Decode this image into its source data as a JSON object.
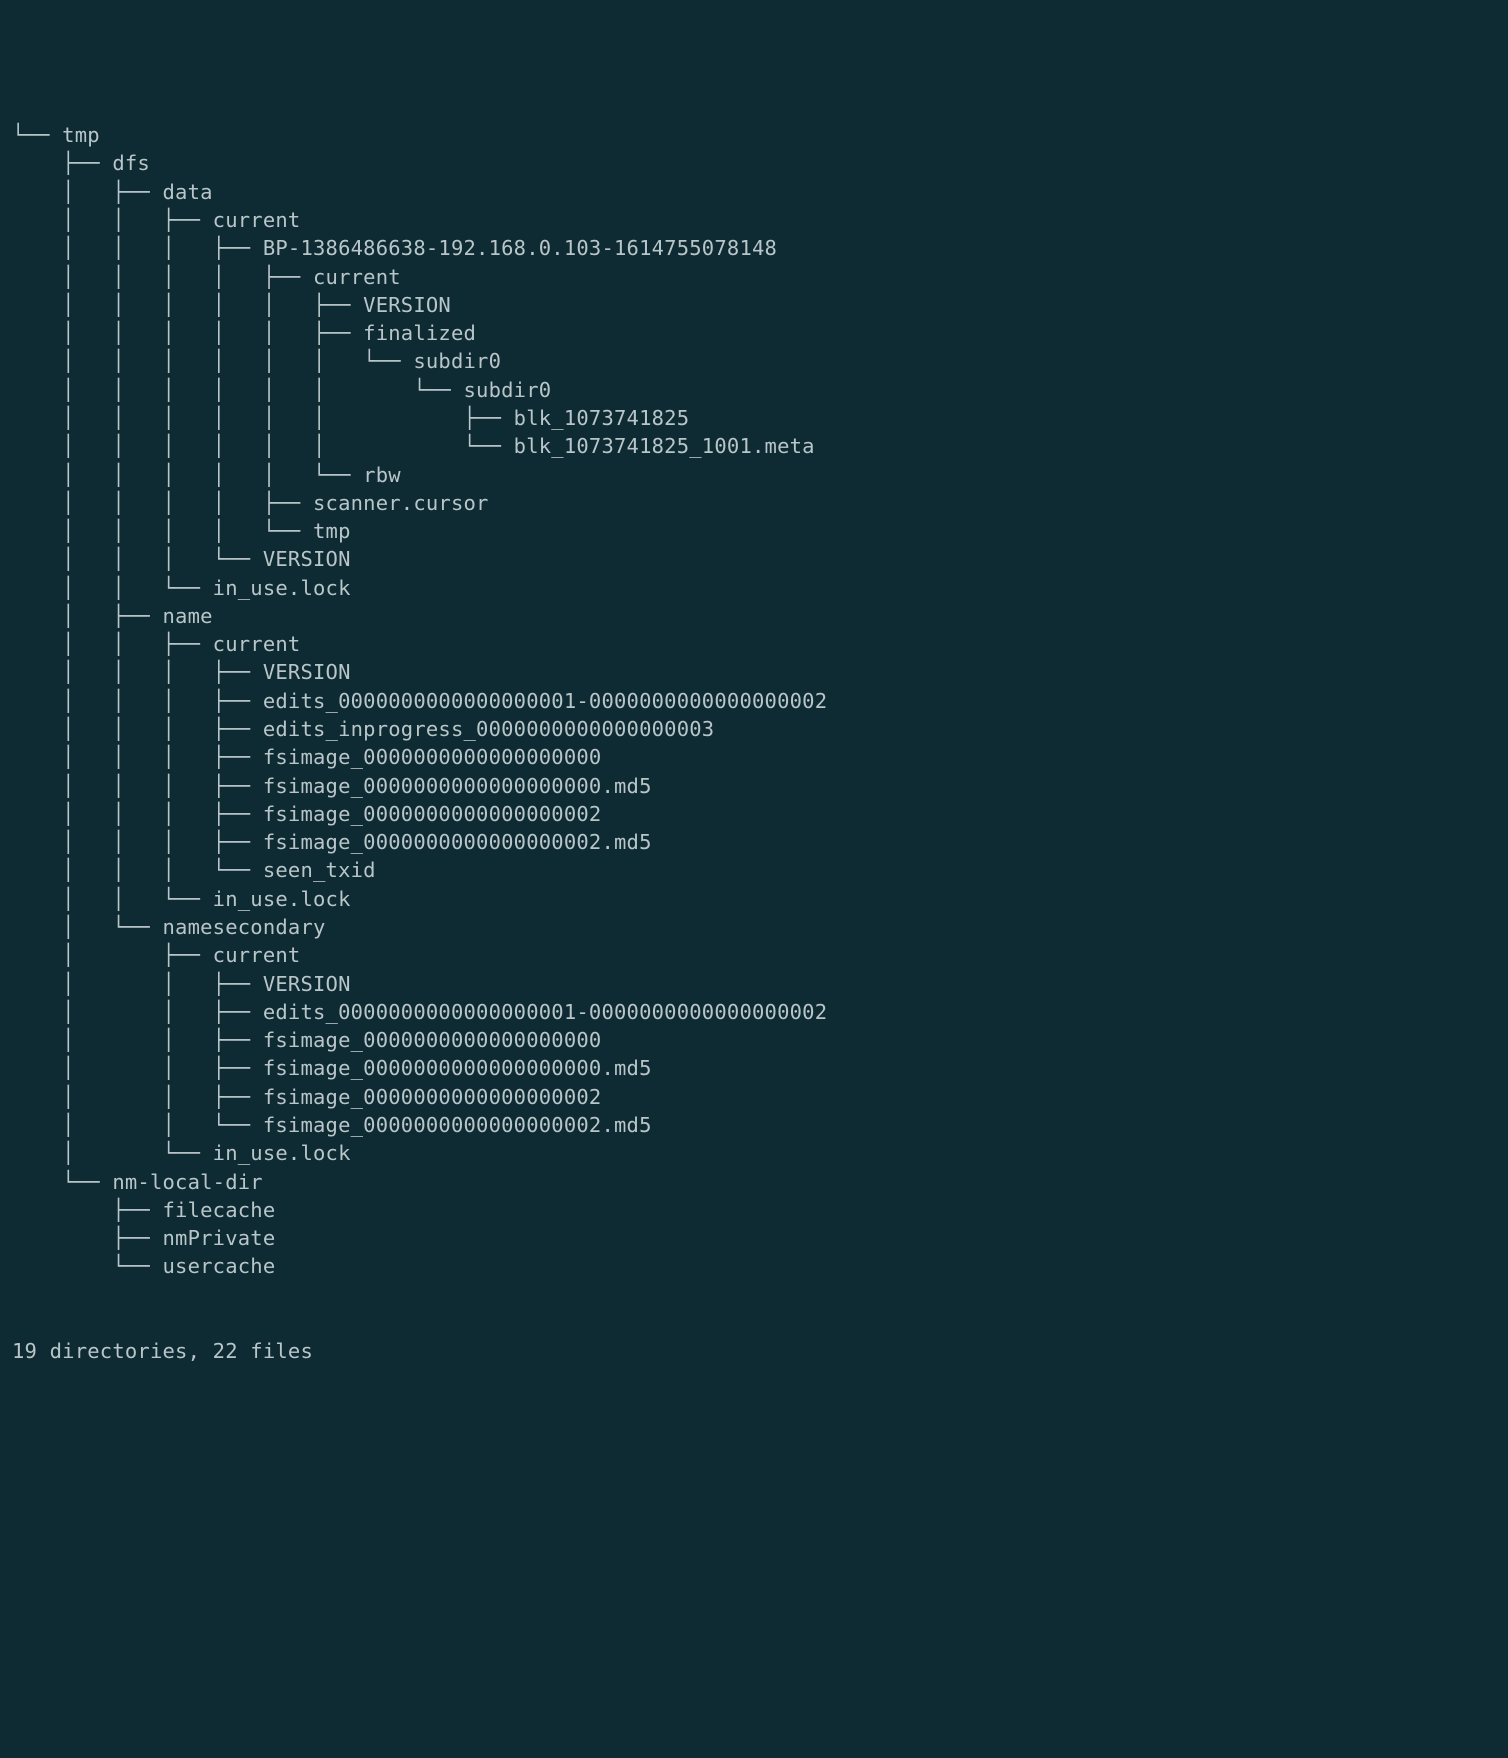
{
  "tree": {
    "lines": [
      "└── tmp",
      "    ├── dfs",
      "    │   ├── data",
      "    │   │   ├── current",
      "    │   │   │   ├── BP-1386486638-192.168.0.103-1614755078148",
      "    │   │   │   │   ├── current",
      "    │   │   │   │   │   ├── VERSION",
      "    │   │   │   │   │   ├── finalized",
      "    │   │   │   │   │   │   └── subdir0",
      "    │   │   │   │   │   │       └── subdir0",
      "    │   │   │   │   │   │           ├── blk_1073741825",
      "    │   │   │   │   │   │           └── blk_1073741825_1001.meta",
      "    │   │   │   │   │   └── rbw",
      "    │   │   │   │   ├── scanner.cursor",
      "    │   │   │   │   └── tmp",
      "    │   │   │   └── VERSION",
      "    │   │   └── in_use.lock",
      "    │   ├── name",
      "    │   │   ├── current",
      "    │   │   │   ├── VERSION",
      "    │   │   │   ├── edits_0000000000000000001-0000000000000000002",
      "    │   │   │   ├── edits_inprogress_0000000000000000003",
      "    │   │   │   ├── fsimage_0000000000000000000",
      "    │   │   │   ├── fsimage_0000000000000000000.md5",
      "    │   │   │   ├── fsimage_0000000000000000002",
      "    │   │   │   ├── fsimage_0000000000000000002.md5",
      "    │   │   │   └── seen_txid",
      "    │   │   └── in_use.lock",
      "    │   └── namesecondary",
      "    │       ├── current",
      "    │       │   ├── VERSION",
      "    │       │   ├── edits_0000000000000000001-0000000000000000002",
      "    │       │   ├── fsimage_0000000000000000000",
      "    │       │   ├── fsimage_0000000000000000000.md5",
      "    │       │   ├── fsimage_0000000000000000002",
      "    │       │   └── fsimage_0000000000000000002.md5",
      "    │       └── in_use.lock",
      "    └── nm-local-dir",
      "        ├── filecache",
      "        ├── nmPrivate",
      "        └── usercache"
    ]
  },
  "summary": "19 directories, 22 files"
}
